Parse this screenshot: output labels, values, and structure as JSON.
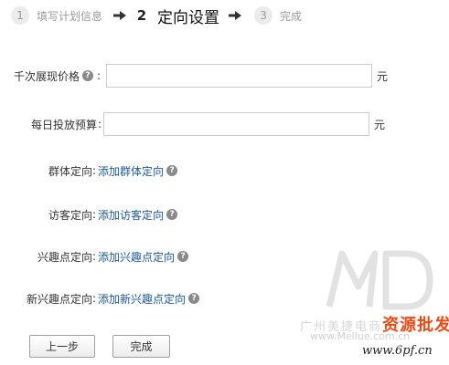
{
  "steps": [
    {
      "number": "1",
      "label": "填写计划信息",
      "state": "done"
    },
    {
      "number": "2",
      "label": "定向设置",
      "state": "active"
    },
    {
      "number": "3",
      "label": "完成",
      "state": "pending"
    }
  ],
  "arrow_icon": "right-arrow-icon",
  "help_icon": "question-circle-icon",
  "form": {
    "cpm_price": {
      "label": "千次展现价格",
      "colon": ":",
      "value": "",
      "unit": "元"
    },
    "daily_budget": {
      "label": "每日投放预算",
      "colon": ":",
      "value": "",
      "unit": "元"
    },
    "group_targeting": {
      "label": "群体定向",
      "colon": ":",
      "link": "添加群体定向"
    },
    "visitor_targeting": {
      "label": "访客定向",
      "colon": ":",
      "link": "添加访客定向"
    },
    "interest_targeting": {
      "label": "兴趣点定向",
      "colon": ":",
      "link": "添加兴趣点定向"
    },
    "new_interest_targeting": {
      "label": "新兴趣点定向",
      "colon": ":",
      "link": "添加新兴趣点定向"
    }
  },
  "buttons": {
    "prev": "上一步",
    "finish": "完成"
  },
  "watermark": {
    "line1_gray": "广州美捷电商",
    "line1_highlight": "资源批发网",
    "line2": "www.Mellue.com.cn",
    "line3": "www.6pf.cn"
  },
  "colors": {
    "link": "#1a5a9a",
    "step_inactive_bg": "#ececec",
    "watermark_highlight": "#f04a12"
  }
}
